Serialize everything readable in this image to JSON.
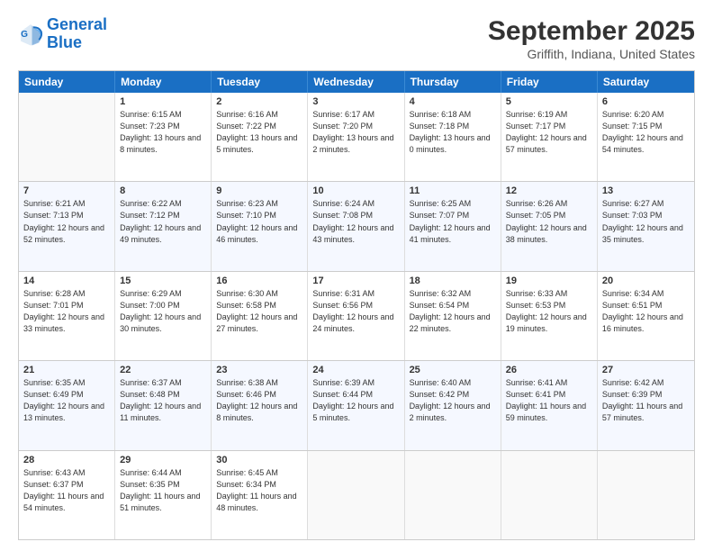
{
  "logo": {
    "line1": "General",
    "line2": "Blue"
  },
  "title": "September 2025",
  "location": "Griffith, Indiana, United States",
  "headers": [
    "Sunday",
    "Monday",
    "Tuesday",
    "Wednesday",
    "Thursday",
    "Friday",
    "Saturday"
  ],
  "weeks": [
    [
      {
        "day": "",
        "sunrise": "",
        "sunset": "",
        "daylight": "",
        "empty": true
      },
      {
        "day": "1",
        "sunrise": "Sunrise: 6:15 AM",
        "sunset": "Sunset: 7:23 PM",
        "daylight": "Daylight: 13 hours and 8 minutes."
      },
      {
        "day": "2",
        "sunrise": "Sunrise: 6:16 AM",
        "sunset": "Sunset: 7:22 PM",
        "daylight": "Daylight: 13 hours and 5 minutes."
      },
      {
        "day": "3",
        "sunrise": "Sunrise: 6:17 AM",
        "sunset": "Sunset: 7:20 PM",
        "daylight": "Daylight: 13 hours and 2 minutes."
      },
      {
        "day": "4",
        "sunrise": "Sunrise: 6:18 AM",
        "sunset": "Sunset: 7:18 PM",
        "daylight": "Daylight: 13 hours and 0 minutes."
      },
      {
        "day": "5",
        "sunrise": "Sunrise: 6:19 AM",
        "sunset": "Sunset: 7:17 PM",
        "daylight": "Daylight: 12 hours and 57 minutes."
      },
      {
        "day": "6",
        "sunrise": "Sunrise: 6:20 AM",
        "sunset": "Sunset: 7:15 PM",
        "daylight": "Daylight: 12 hours and 54 minutes."
      }
    ],
    [
      {
        "day": "7",
        "sunrise": "Sunrise: 6:21 AM",
        "sunset": "Sunset: 7:13 PM",
        "daylight": "Daylight: 12 hours and 52 minutes."
      },
      {
        "day": "8",
        "sunrise": "Sunrise: 6:22 AM",
        "sunset": "Sunset: 7:12 PM",
        "daylight": "Daylight: 12 hours and 49 minutes."
      },
      {
        "day": "9",
        "sunrise": "Sunrise: 6:23 AM",
        "sunset": "Sunset: 7:10 PM",
        "daylight": "Daylight: 12 hours and 46 minutes."
      },
      {
        "day": "10",
        "sunrise": "Sunrise: 6:24 AM",
        "sunset": "Sunset: 7:08 PM",
        "daylight": "Daylight: 12 hours and 43 minutes."
      },
      {
        "day": "11",
        "sunrise": "Sunrise: 6:25 AM",
        "sunset": "Sunset: 7:07 PM",
        "daylight": "Daylight: 12 hours and 41 minutes."
      },
      {
        "day": "12",
        "sunrise": "Sunrise: 6:26 AM",
        "sunset": "Sunset: 7:05 PM",
        "daylight": "Daylight: 12 hours and 38 minutes."
      },
      {
        "day": "13",
        "sunrise": "Sunrise: 6:27 AM",
        "sunset": "Sunset: 7:03 PM",
        "daylight": "Daylight: 12 hours and 35 minutes."
      }
    ],
    [
      {
        "day": "14",
        "sunrise": "Sunrise: 6:28 AM",
        "sunset": "Sunset: 7:01 PM",
        "daylight": "Daylight: 12 hours and 33 minutes."
      },
      {
        "day": "15",
        "sunrise": "Sunrise: 6:29 AM",
        "sunset": "Sunset: 7:00 PM",
        "daylight": "Daylight: 12 hours and 30 minutes."
      },
      {
        "day": "16",
        "sunrise": "Sunrise: 6:30 AM",
        "sunset": "Sunset: 6:58 PM",
        "daylight": "Daylight: 12 hours and 27 minutes."
      },
      {
        "day": "17",
        "sunrise": "Sunrise: 6:31 AM",
        "sunset": "Sunset: 6:56 PM",
        "daylight": "Daylight: 12 hours and 24 minutes."
      },
      {
        "day": "18",
        "sunrise": "Sunrise: 6:32 AM",
        "sunset": "Sunset: 6:54 PM",
        "daylight": "Daylight: 12 hours and 22 minutes."
      },
      {
        "day": "19",
        "sunrise": "Sunrise: 6:33 AM",
        "sunset": "Sunset: 6:53 PM",
        "daylight": "Daylight: 12 hours and 19 minutes."
      },
      {
        "day": "20",
        "sunrise": "Sunrise: 6:34 AM",
        "sunset": "Sunset: 6:51 PM",
        "daylight": "Daylight: 12 hours and 16 minutes."
      }
    ],
    [
      {
        "day": "21",
        "sunrise": "Sunrise: 6:35 AM",
        "sunset": "Sunset: 6:49 PM",
        "daylight": "Daylight: 12 hours and 13 minutes."
      },
      {
        "day": "22",
        "sunrise": "Sunrise: 6:37 AM",
        "sunset": "Sunset: 6:48 PM",
        "daylight": "Daylight: 12 hours and 11 minutes."
      },
      {
        "day": "23",
        "sunrise": "Sunrise: 6:38 AM",
        "sunset": "Sunset: 6:46 PM",
        "daylight": "Daylight: 12 hours and 8 minutes."
      },
      {
        "day": "24",
        "sunrise": "Sunrise: 6:39 AM",
        "sunset": "Sunset: 6:44 PM",
        "daylight": "Daylight: 12 hours and 5 minutes."
      },
      {
        "day": "25",
        "sunrise": "Sunrise: 6:40 AM",
        "sunset": "Sunset: 6:42 PM",
        "daylight": "Daylight: 12 hours and 2 minutes."
      },
      {
        "day": "26",
        "sunrise": "Sunrise: 6:41 AM",
        "sunset": "Sunset: 6:41 PM",
        "daylight": "Daylight: 11 hours and 59 minutes."
      },
      {
        "day": "27",
        "sunrise": "Sunrise: 6:42 AM",
        "sunset": "Sunset: 6:39 PM",
        "daylight": "Daylight: 11 hours and 57 minutes."
      }
    ],
    [
      {
        "day": "28",
        "sunrise": "Sunrise: 6:43 AM",
        "sunset": "Sunset: 6:37 PM",
        "daylight": "Daylight: 11 hours and 54 minutes."
      },
      {
        "day": "29",
        "sunrise": "Sunrise: 6:44 AM",
        "sunset": "Sunset: 6:35 PM",
        "daylight": "Daylight: 11 hours and 51 minutes."
      },
      {
        "day": "30",
        "sunrise": "Sunrise: 6:45 AM",
        "sunset": "Sunset: 6:34 PM",
        "daylight": "Daylight: 11 hours and 48 minutes."
      },
      {
        "day": "",
        "sunrise": "",
        "sunset": "",
        "daylight": "",
        "empty": true
      },
      {
        "day": "",
        "sunrise": "",
        "sunset": "",
        "daylight": "",
        "empty": true
      },
      {
        "day": "",
        "sunrise": "",
        "sunset": "",
        "daylight": "",
        "empty": true
      },
      {
        "day": "",
        "sunrise": "",
        "sunset": "",
        "daylight": "",
        "empty": true
      }
    ]
  ]
}
